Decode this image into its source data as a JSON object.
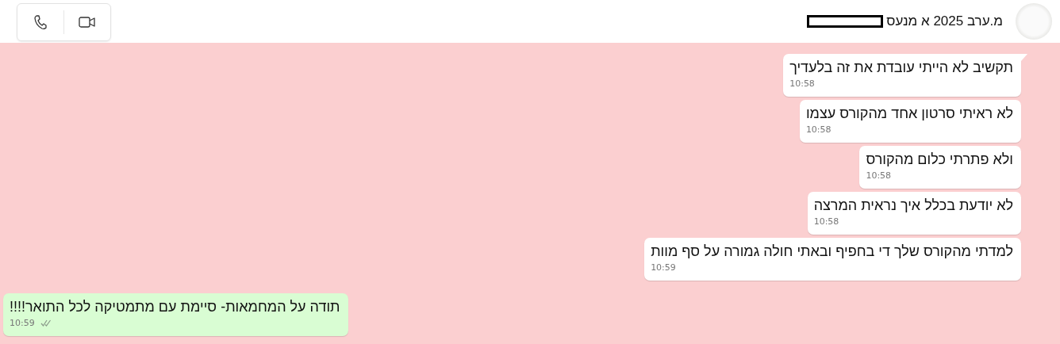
{
  "header": {
    "title": "מ.ערב 2025 א מנעס",
    "title_redacted": true
  },
  "messages": [
    {
      "kind": "outgoing",
      "text": "תקשיב לא הייתי עובדת את זה בלעדיך",
      "time": "10:58",
      "tail": true
    },
    {
      "kind": "outgoing",
      "text": "לא ראיתי סרטון אחד מהקורס עצמו",
      "time": "10:58",
      "tail": false
    },
    {
      "kind": "outgoing",
      "text": "ולא פתרתי כלום מהקורס",
      "time": "10:58",
      "tail": false
    },
    {
      "kind": "outgoing",
      "text": "לא יודעת בכלל איך נראית המרצה",
      "time": "10:58",
      "tail": false
    },
    {
      "kind": "outgoing",
      "text": "למדתי מהקורס שלך די בחפיף ובאתי חולה גמורה על סף מוות",
      "time": "10:59",
      "tail": false
    },
    {
      "kind": "incoming",
      "text": "תודה על המחמאות- סיימת עם מתמטיקה לכל התואר!!!!",
      "time": "10:59",
      "tail": false,
      "read": false
    }
  ]
}
